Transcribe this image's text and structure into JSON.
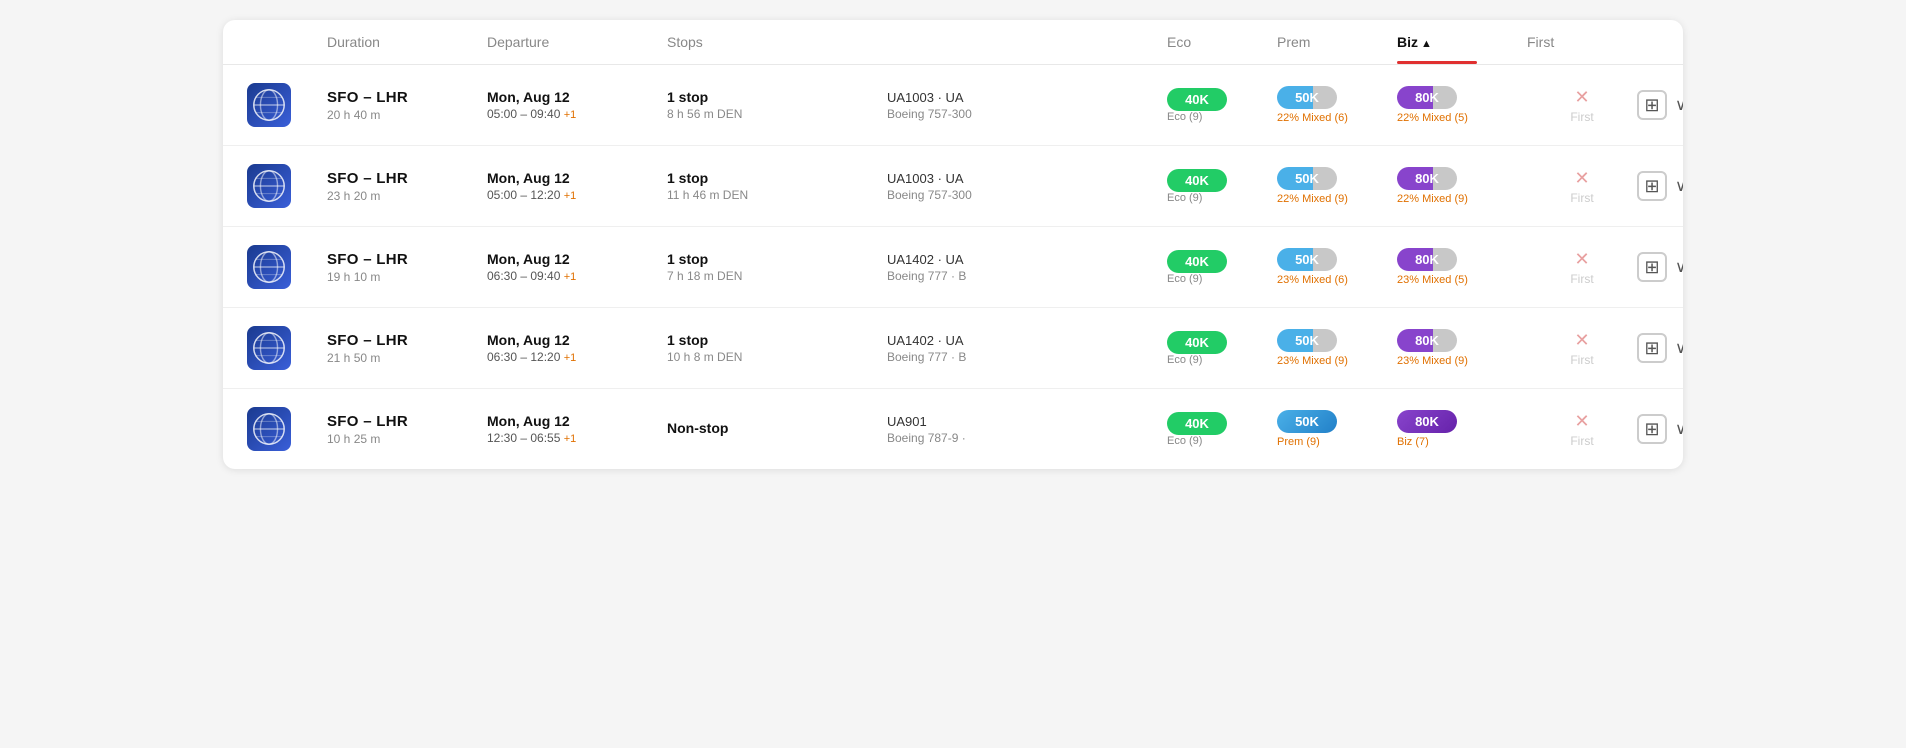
{
  "header": {
    "cols": [
      {
        "id": "icon",
        "label": ""
      },
      {
        "id": "duration",
        "label": "Duration"
      },
      {
        "id": "departure",
        "label": "Departure"
      },
      {
        "id": "stops",
        "label": "Stops"
      },
      {
        "id": "flight",
        "label": ""
      },
      {
        "id": "eco",
        "label": "Eco"
      },
      {
        "id": "prem",
        "label": "Prem"
      },
      {
        "id": "biz",
        "label": "Biz",
        "active": true,
        "sort": "▲"
      },
      {
        "id": "first",
        "label": "First"
      },
      {
        "id": "actions",
        "label": ""
      }
    ]
  },
  "rows": [
    {
      "route": "SFO – LHR",
      "duration": "20 h 40 m",
      "depDate": "Mon, Aug 12",
      "depTime": "05:00 – 09:40",
      "depPlus": "+1",
      "stops": "1 stop",
      "stopDuration": "8 h 56 m DEN",
      "flightNum": "UA1003 · UA",
      "aircraft": "Boeing 757-300",
      "ecoBadge": "40K",
      "ecoSub": "Eco (9)",
      "premBadge": "50K",
      "premSub": "22% Mixed (6)",
      "bizBadge": "80K",
      "bizSub": "22% Mixed (5)",
      "firstAvail": false,
      "firstLabel": "First"
    },
    {
      "route": "SFO – LHR",
      "duration": "23 h 20 m",
      "depDate": "Mon, Aug 12",
      "depTime": "05:00 – 12:20",
      "depPlus": "+1",
      "stops": "1 stop",
      "stopDuration": "11 h 46 m DEN",
      "flightNum": "UA1003 · UA",
      "aircraft": "Boeing 757-300",
      "ecoBadge": "40K",
      "ecoSub": "Eco (9)",
      "premBadge": "50K",
      "premSub": "22% Mixed (9)",
      "bizBadge": "80K",
      "bizSub": "22% Mixed (9)",
      "firstAvail": false,
      "firstLabel": "First"
    },
    {
      "route": "SFO – LHR",
      "duration": "19 h 10 m",
      "depDate": "Mon, Aug 12",
      "depTime": "06:30 – 09:40",
      "depPlus": "+1",
      "stops": "1 stop",
      "stopDuration": "7 h 18 m DEN",
      "flightNum": "UA1402 · UA",
      "aircraft": "Boeing 777 · B",
      "ecoBadge": "40K",
      "ecoSub": "Eco (9)",
      "premBadge": "50K",
      "premSub": "23% Mixed (6)",
      "bizBadge": "80K",
      "bizSub": "23% Mixed (5)",
      "firstAvail": false,
      "firstLabel": "First"
    },
    {
      "route": "SFO – LHR",
      "duration": "21 h 50 m",
      "depDate": "Mon, Aug 12",
      "depTime": "06:30 – 12:20",
      "depPlus": "+1",
      "stops": "1 stop",
      "stopDuration": "10 h 8 m DEN",
      "flightNum": "UA1402 · UA",
      "aircraft": "Boeing 777 · B",
      "ecoBadge": "40K",
      "ecoSub": "Eco (9)",
      "premBadge": "50K",
      "premSub": "23% Mixed (9)",
      "bizBadge": "80K",
      "bizSub": "23% Mixed (9)",
      "firstAvail": false,
      "firstLabel": "First"
    },
    {
      "route": "SFO – LHR",
      "duration": "10 h 25 m",
      "depDate": "Mon, Aug 12",
      "depTime": "12:30 – 06:55",
      "depPlus": "+1",
      "stops": "Non-stop",
      "stopDuration": "",
      "flightNum": "UA901",
      "aircraft": "Boeing 787-9 ·",
      "ecoBadge": "40K",
      "ecoSub": "Eco (9)",
      "premBadge": "50K",
      "premSub": "Prem (9)",
      "bizBadge": "80K",
      "bizSub": "Biz (7)",
      "firstAvail": false,
      "firstLabel": "First"
    }
  ],
  "badges": {
    "eco_color": "#22cc66",
    "prem_color_start": "#4ab0e8",
    "prem_color_end": "#2280c8",
    "biz_color_start": "#8844cc",
    "biz_color_end": "#6622aa"
  }
}
